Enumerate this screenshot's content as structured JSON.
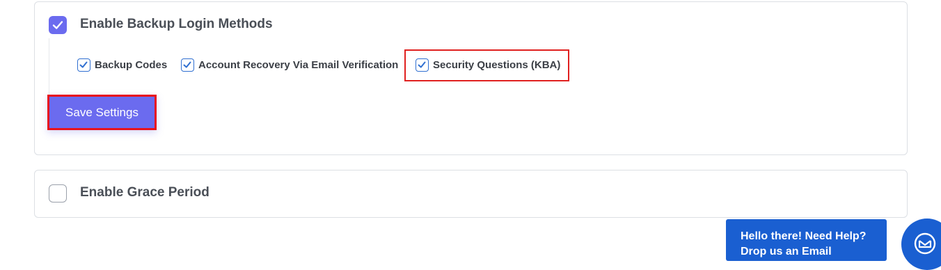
{
  "backup_section": {
    "title": "Enable Backup Login Methods",
    "checked": true,
    "options": [
      {
        "label": "Backup Codes",
        "checked": true
      },
      {
        "label": "Account Recovery Via Email Verification",
        "checked": true
      },
      {
        "label": "Security Questions (KBA)",
        "checked": true
      }
    ],
    "save_label": "Save Settings"
  },
  "grace_section": {
    "title": "Enable Grace Period",
    "checked": false
  },
  "help_widget": {
    "line1": "Hello there! Need Help?",
    "line2": "Drop us an Email"
  },
  "colors": {
    "accent": "#6b6bef",
    "highlight": "#e0201f",
    "help_blue": "#1a5fd1"
  }
}
